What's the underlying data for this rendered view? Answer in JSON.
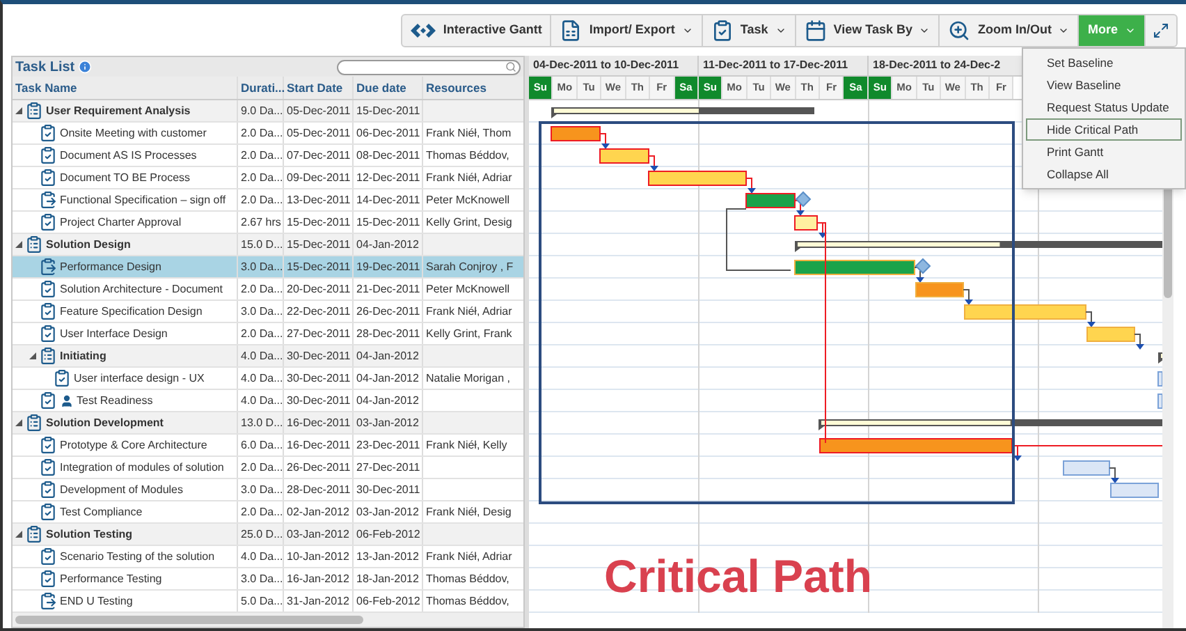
{
  "toolbar": {
    "buttons": [
      {
        "label": "Interactive Gantt",
        "kind": "gantt",
        "dropdown": false,
        "selected": false
      },
      {
        "label": "Import/ Export",
        "kind": "import",
        "dropdown": true,
        "selected": false
      },
      {
        "label": "Task",
        "kind": "task",
        "dropdown": true,
        "selected": false
      },
      {
        "label": "View Task By",
        "kind": "calendar",
        "dropdown": true,
        "selected": false
      },
      {
        "label": "Zoom In/Out",
        "kind": "zoom",
        "dropdown": true,
        "selected": false
      },
      {
        "label": "More",
        "kind": "more",
        "dropdown": true,
        "selected": true
      }
    ]
  },
  "task_list": {
    "title": "Task List",
    "columns": [
      "Task Name",
      "Durati...",
      "Start Date",
      "Due date",
      "Resources"
    ],
    "tasks": [
      {
        "name": "User Requirement Analysis",
        "kind": "summary",
        "expanded": true,
        "selected": false,
        "duration": "9.0 Da...",
        "start": "05-Dec-2011",
        "due": "15-Dec-2011",
        "children": [
          {
            "name": "Onsite Meeting with customer",
            "kind": "task",
            "selected": false,
            "duration": "2.0 Da...",
            "start": "05-Dec-2011",
            "due": "06-Dec-2011",
            "resources": "Frank Niéł, Thom"
          },
          {
            "name": "Document AS IS Processes",
            "kind": "task",
            "selected": false,
            "duration": "2.0 Da...",
            "start": "07-Dec-2011",
            "due": "08-Dec-2011",
            "resources": "Thomas Béddov,"
          },
          {
            "name": "Document TO BE Process",
            "kind": "task",
            "selected": false,
            "duration": "2.0 Da...",
            "start": "09-Dec-2011",
            "due": "12-Dec-2011",
            "resources": "Frank Niéł, Adriar"
          },
          {
            "name": "Functional Specification – sign off",
            "kind": "milestone",
            "selected": false,
            "duration": "2.0 Da...",
            "start": "13-Dec-2011",
            "due": "14-Dec-2011",
            "resources": "Peter McKnowell"
          },
          {
            "name": "Project Charter Approval",
            "kind": "task",
            "selected": false,
            "duration": "2.67 hrs",
            "start": "15-Dec-2011",
            "due": "15-Dec-2011",
            "resources": "Kelly Grint, Desig"
          }
        ]
      },
      {
        "name": "Solution Design",
        "kind": "summary",
        "expanded": true,
        "selected": false,
        "duration": "15.0 D...",
        "start": "15-Dec-2011",
        "due": "04-Jan-2012",
        "children": [
          {
            "name": "Performance Design",
            "kind": "milestone",
            "selected": true,
            "duration": "3.0 Da...",
            "start": "15-Dec-2011",
            "due": "19-Dec-2011",
            "resources": "Sarah Conjroy , F"
          },
          {
            "name": "Solution Architecture - Document",
            "kind": "task",
            "selected": false,
            "duration": "2.0 Da...",
            "start": "20-Dec-2011",
            "due": "21-Dec-2011",
            "resources": "Peter McKnowell"
          },
          {
            "name": "Feature Specification Design",
            "kind": "task",
            "selected": false,
            "duration": "3.0 Da...",
            "start": "22-Dec-2011",
            "due": "26-Dec-2011",
            "resources": "Frank Niéł, Adriar"
          },
          {
            "name": "User Interface Design",
            "kind": "task",
            "selected": false,
            "duration": "2.0 Da...",
            "start": "27-Dec-2011",
            "due": "28-Dec-2011",
            "resources": "Kelly Grint, Frank"
          },
          {
            "name": "Initiating",
            "kind": "summary",
            "expanded": true,
            "selected": false,
            "duration": "4.0 Da...",
            "start": "30-Dec-2011",
            "due": "04-Jan-2012",
            "children": [
              {
                "name": "User interface design - UX",
                "kind": "task",
                "selected": false,
                "duration": "4.0 Da...",
                "start": "30-Dec-2011",
                "due": "04-Jan-2012",
                "resources": "Natalie Morigan ,"
              }
            ]
          },
          {
            "name": "Test Readiness",
            "kind": "user",
            "selected": false,
            "duration": "4.0 Da...",
            "start": "30-Dec-2011",
            "due": "04-Jan-2012"
          }
        ]
      },
      {
        "name": "Solution Development",
        "kind": "summary",
        "expanded": true,
        "selected": false,
        "duration": "13.0 D...",
        "start": "16-Dec-2011",
        "due": "03-Jan-2012",
        "children": [
          {
            "name": "Prototype & Core Architecture",
            "kind": "task",
            "selected": false,
            "duration": "6.0 Da...",
            "start": "16-Dec-2011",
            "due": "23-Dec-2011",
            "resources": "Frank Niéł, Kelly"
          },
          {
            "name": "Integration of modules of solution",
            "kind": "task",
            "selected": false,
            "duration": "2.0 Da...",
            "start": "26-Dec-2011",
            "due": "27-Dec-2011"
          },
          {
            "name": "Development of Modules",
            "kind": "task",
            "selected": false,
            "duration": "3.0 Da...",
            "start": "28-Dec-2011",
            "due": "30-Dec-2011"
          },
          {
            "name": "Test Compliance",
            "kind": "task",
            "selected": false,
            "duration": "2.0 Da...",
            "start": "02-Jan-2012",
            "due": "03-Jan-2012",
            "resources": "Frank Niéł, Desig"
          }
        ]
      },
      {
        "name": "Solution Testing",
        "kind": "summary",
        "expanded": true,
        "selected": false,
        "duration": "25.0 D...",
        "start": "03-Jan-2012",
        "due": "06-Feb-2012",
        "children": [
          {
            "name": "Scenario Testing of the solution",
            "kind": "task",
            "selected": false,
            "duration": "4.0 Da...",
            "start": "10-Jan-2012",
            "due": "13-Jan-2012",
            "resources": "Frank Niéł, Adriar"
          },
          {
            "name": "Performance Testing",
            "kind": "task",
            "selected": false,
            "duration": "3.0 Da...",
            "start": "16-Jan-2012",
            "due": "18-Jan-2012",
            "resources": "Thomas Béddov,"
          },
          {
            "name": "END U Testing",
            "kind": "milestone",
            "selected": false,
            "duration": "5.0 Da...",
            "start": "31-Jan-2012",
            "due": "06-Feb-2012",
            "resources": "Thomas Béddov,"
          }
        ]
      }
    ]
  },
  "timeline": {
    "weeks": [
      "04-Dec-2011 to 10-Dec-2011",
      "11-Dec-2011 to 17-Dec-2011",
      "18-Dec-2011 to 24-Dec-2"
    ],
    "days": [
      {
        "label": "Su",
        "weekend": true
      },
      {
        "label": "Mo",
        "weekend": false
      },
      {
        "label": "Tu",
        "weekend": false
      },
      {
        "label": "We",
        "weekend": false
      },
      {
        "label": "Th",
        "weekend": false
      },
      {
        "label": "Fr",
        "weekend": false
      },
      {
        "label": "Sa",
        "weekend": true
      },
      {
        "label": "Su",
        "weekend": true
      },
      {
        "label": "Mo",
        "weekend": false
      },
      {
        "label": "Tu",
        "weekend": false
      },
      {
        "label": "We",
        "weekend": false
      },
      {
        "label": "Th",
        "weekend": false
      },
      {
        "label": "Fr",
        "weekend": false
      },
      {
        "label": "Sa",
        "weekend": true
      },
      {
        "label": "Su",
        "weekend": true
      },
      {
        "label": "Mo",
        "weekend": false
      },
      {
        "label": "Tu",
        "weekend": false
      },
      {
        "label": "We",
        "weekend": false
      },
      {
        "label": "Th",
        "weekend": false
      },
      {
        "label": "Fr",
        "weekend": false
      }
    ]
  },
  "more_menu": {
    "items": [
      {
        "label": "Set Baseline",
        "selected": false
      },
      {
        "label": "View Baseline",
        "selected": false
      },
      {
        "label": "Request Status Update",
        "selected": false
      },
      {
        "label": "Hide Critical Path",
        "selected": true
      },
      {
        "label": "Print Gantt",
        "selected": false
      },
      {
        "label": "Collapse All",
        "selected": false
      }
    ]
  },
  "annotation": "Critical Path"
}
